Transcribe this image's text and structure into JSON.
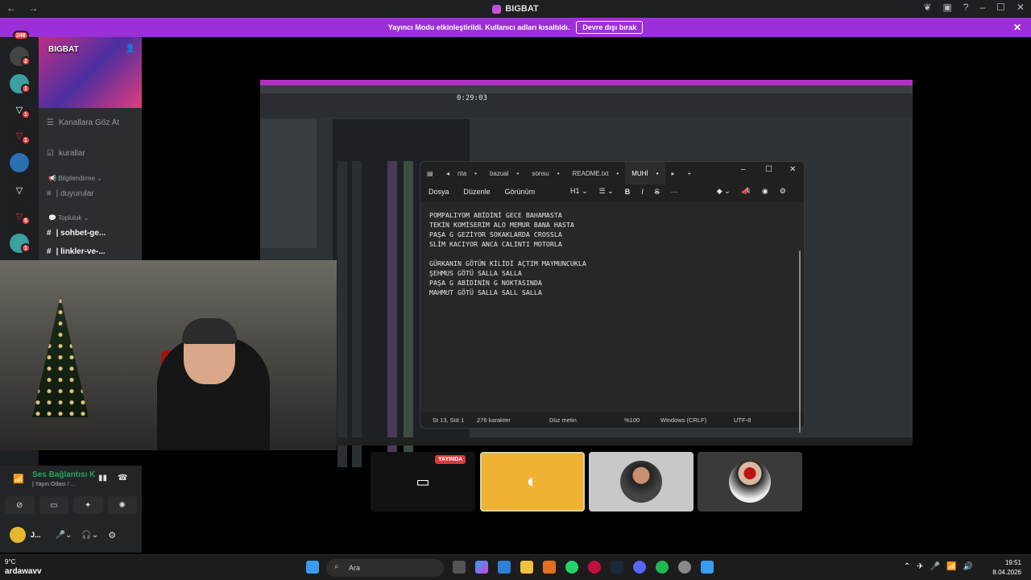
{
  "titlebar": {
    "title": "BIGBAT"
  },
  "banner": {
    "message": "Yayıncı Modu etkinleştirildi. Kullanıcı adları kısaltıldı.",
    "button": "Devre dışı bırak"
  },
  "rail": {
    "badges": [
      "248",
      "2",
      "1",
      "1",
      "1",
      "1",
      "1",
      "5",
      "1"
    ]
  },
  "sidebar": {
    "server_name": "BIGBAT",
    "items": [
      {
        "label": "Kanallara Göz At"
      },
      {
        "label": "kurallar"
      }
    ],
    "categories": [
      "Bilgilendirme",
      "Topluluk"
    ],
    "channels": [
      "| duyurular",
      "| sohbet-ge...",
      "| linkler-ve-..."
    ]
  },
  "voice": {
    "status": "Ses Bağlantısı K",
    "room": "| Yayın Odası / ...",
    "username": "J..."
  },
  "fl": {
    "time": "0:29:03"
  },
  "notepad": {
    "tabs": [
      "nta",
      "bazual",
      "sonsu",
      "README.txt",
      "MUHİ"
    ],
    "menu": [
      "Dosya",
      "Düzenle",
      "Görünüm"
    ],
    "heading": "H1",
    "lines": [
      "POMPALIYOM ABİDİNİ GECE BAHAMASTA",
      "TEKİN KOMİSERİM ALO MEMUR BANA HASTA",
      "PAŞA G GEZİYOR SOKAKLARDA CROSSLA",
      "SLİM KACIYOR ANCA CALINTI MOTORLA",
      "",
      "GÜRKANIN GÖTÜN KİLİDİ AÇTIM MAYMUNCUKLA",
      "ŞEHMUS GÖTÜ SALLA SALLA",
      "PAŞA G ABİDİNİN G NOKTASINDA",
      "MAHMUT GÖTÜ SALLA SALL SALLA"
    ],
    "status": {
      "position": "St 13, Süt 1",
      "chars": "276 karakter",
      "mode": "Düz metin",
      "zoom": "%100",
      "eol": "Windows (CRLF)",
      "encoding": "UTF-8"
    }
  },
  "tiles": {
    "live_label": "YAYINDA"
  },
  "taskbar": {
    "temperature": "9°C",
    "streamer": "ardawavv",
    "search_placeholder": "Ara",
    "time": "19:51",
    "date": "8.04.2026"
  }
}
